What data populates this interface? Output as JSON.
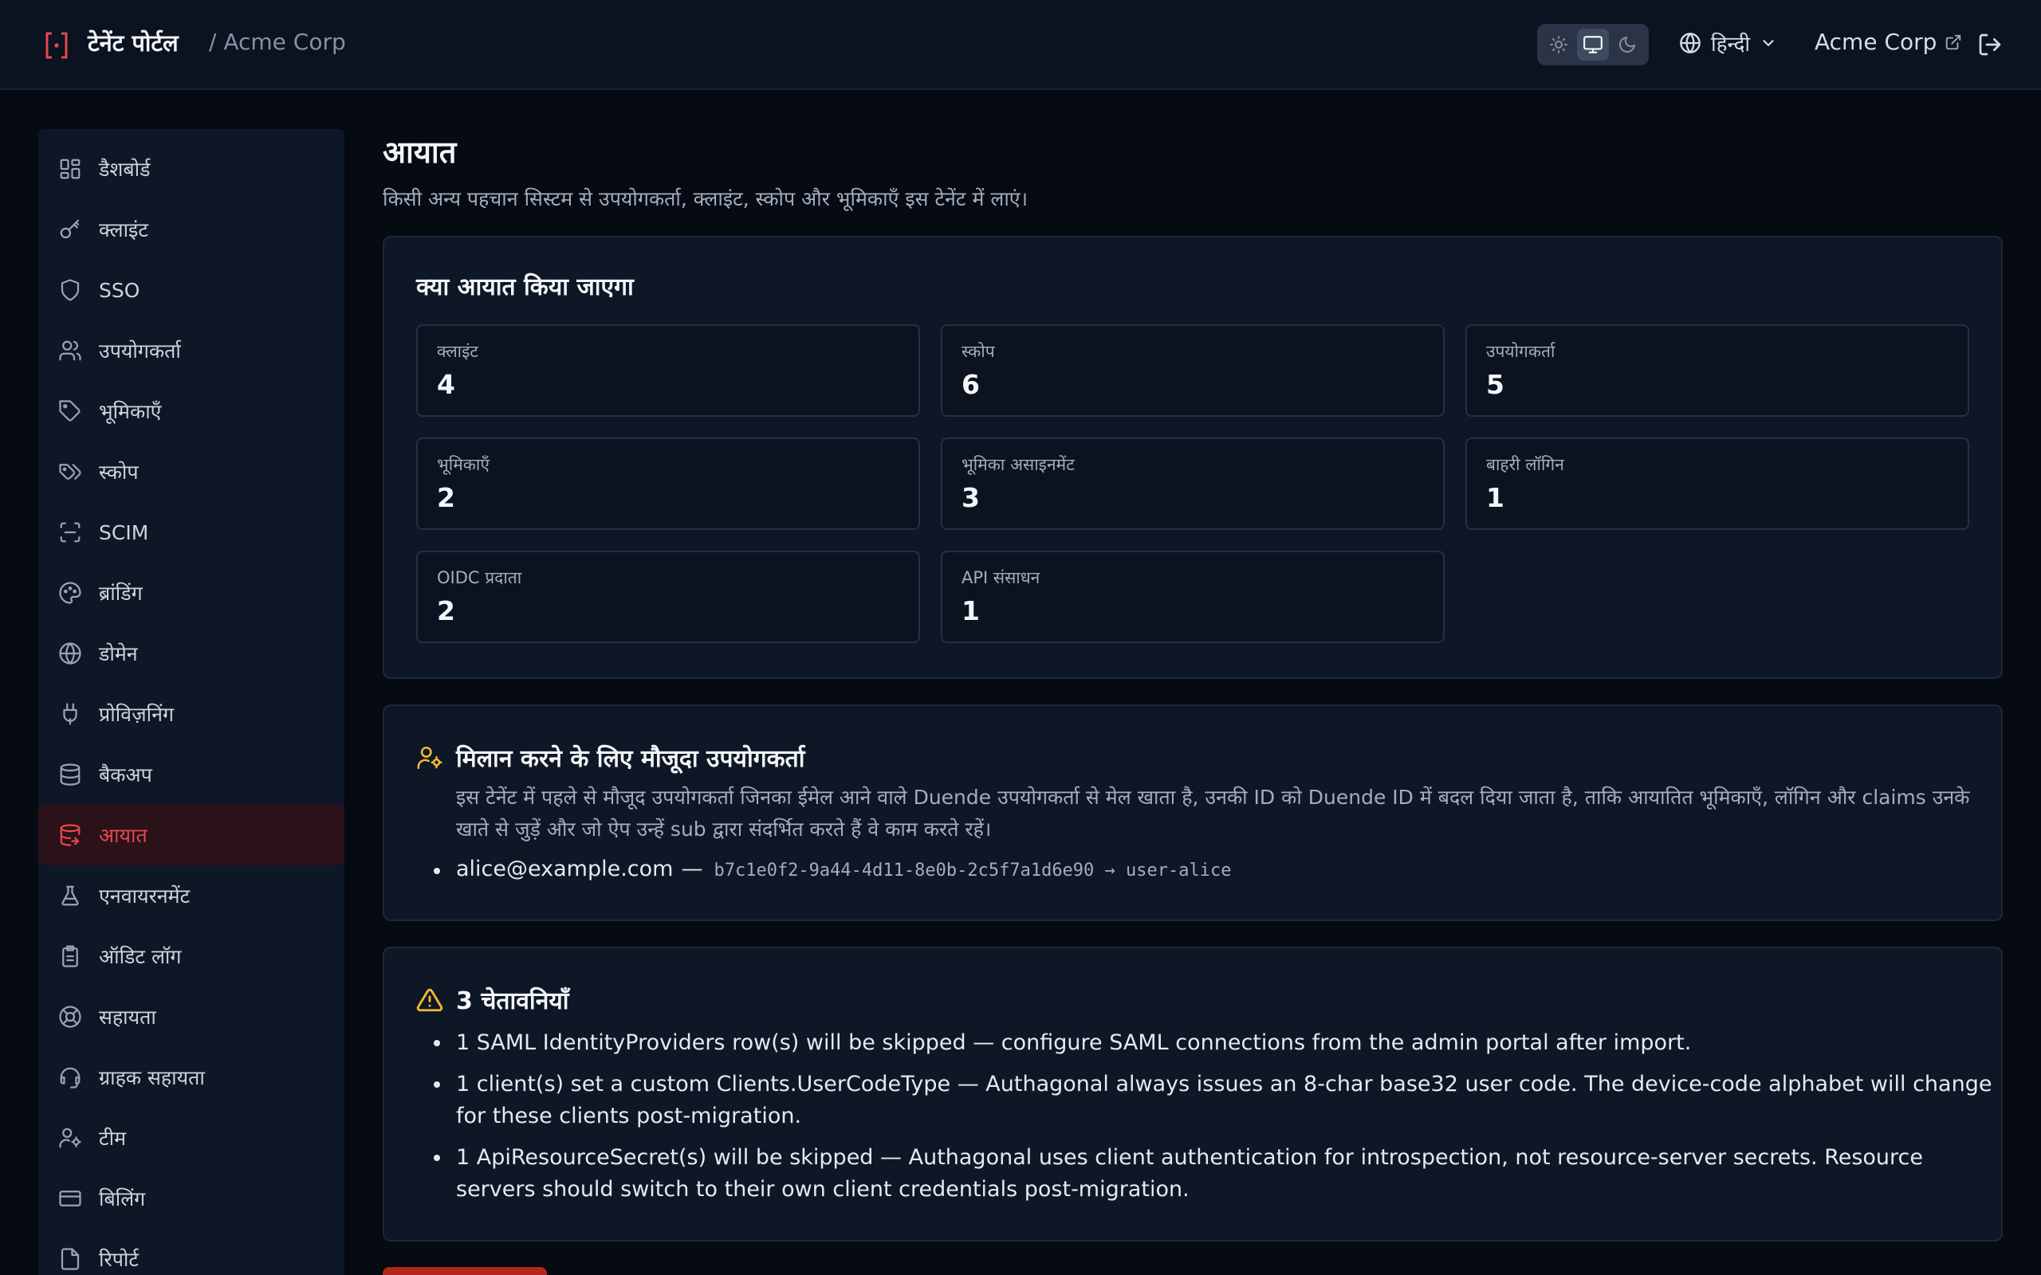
{
  "header": {
    "app_title": "टेनेंट पोर्टल",
    "tenant_crumb": "/ Acme Corp",
    "language": "हिन्दी",
    "org_link": "Acme Corp",
    "theme_options": [
      "sun-icon",
      "monitor-icon",
      "moon-icon"
    ],
    "theme_selected": "monitor-icon"
  },
  "sidebar": {
    "items": [
      {
        "label": "डैशबोर्ड",
        "icon": "dashboard-icon"
      },
      {
        "label": "क्लाइंट",
        "icon": "key-icon"
      },
      {
        "label": "SSO",
        "icon": "shield-icon"
      },
      {
        "label": "उपयोगकर्ता",
        "icon": "users-icon"
      },
      {
        "label": "भूमिकाएँ",
        "icon": "tag-icon"
      },
      {
        "label": "स्कोप",
        "icon": "tags-icon"
      },
      {
        "label": "SCIM",
        "icon": "scan-icon"
      },
      {
        "label": "ब्रांडिंग",
        "icon": "palette-icon"
      },
      {
        "label": "डोमेन",
        "icon": "globe-icon"
      },
      {
        "label": "प्रोविज़निंग",
        "icon": "plug-icon"
      },
      {
        "label": "बैकअप",
        "icon": "database-icon"
      },
      {
        "label": "आयात",
        "icon": "database-import-icon",
        "active": true
      },
      {
        "label": "एनवायरनमेंट",
        "icon": "flask-icon"
      },
      {
        "label": "ऑडिट लॉग",
        "icon": "clipboard-icon"
      },
      {
        "label": "सहायता",
        "icon": "lifebuoy-icon"
      },
      {
        "label": "ग्राहक सहायता",
        "icon": "headset-icon"
      },
      {
        "label": "टीम",
        "icon": "user-cog-icon"
      },
      {
        "label": "बिलिंग",
        "icon": "credit-card-icon"
      },
      {
        "label": "रिपोर्ट",
        "icon": "file-icon"
      }
    ]
  },
  "main": {
    "title": "आयात",
    "subtitle": "किसी अन्य पहचान सिस्टम से उपयोगकर्ता, क्लाइंट, स्कोप और भूमिकाएँ इस टेनेंट में लाएं।",
    "what": {
      "heading": "क्या आयात किया जाएगा",
      "stats": [
        {
          "label": "क्लाइंट",
          "value": "4"
        },
        {
          "label": "स्कोप",
          "value": "6"
        },
        {
          "label": "उपयोगकर्ता",
          "value": "5"
        },
        {
          "label": "भूमिकाएँ",
          "value": "2"
        },
        {
          "label": "भूमिका असाइनमेंट",
          "value": "3"
        },
        {
          "label": "बाहरी लॉगिन",
          "value": "1"
        },
        {
          "label": "OIDC प्रदाता",
          "value": "2"
        },
        {
          "label": "API संसाधन",
          "value": "1"
        }
      ]
    },
    "match": {
      "heading": "मिलान करने के लिए मौजूदा उपयोगकर्ता",
      "description": "इस टेनेंट में पहले से मौजूद उपयोगकर्ता जिनका ईमेल आने वाले Duende उपयोगकर्ता से मेल खाता है, उनकी ID को Duende ID में बदल दिया जाता है, ताकि आयातित भूमिकाएँ, लॉगिन और claims उनके खाते से जुड़ें और जो ऐप उन्हें sub द्वारा संदर्भित करते हैं वे काम करते रहें।",
      "email": "alice@example.com",
      "separator": "—",
      "mapping": "b7c1e0f2-9a44-4d11-8e0b-2c5f7a1d6e90 → user-alice"
    },
    "warnings": {
      "heading": "3 चेतावनियाँ",
      "items": [
        "1 SAML IdentityProviders row(s) will be skipped — configure SAML connections from the admin portal after import.",
        "1 client(s) set a custom Clients.UserCodeType — Authagonal always issues an 8-char base32 user code. The device-code alphabet will change for these clients post-migration.",
        "1 ApiResourceSecret(s) will be skipped — Authagonal uses client authentication for introspection, not resource-server secrets. Resource servers should switch to their own client credentials post-migration."
      ]
    }
  },
  "colors": {
    "accent": "#e5484d",
    "warning": "#f5b82e",
    "background": "#050a13",
    "card": "#0e1726",
    "primary_button": "#b3261e"
  }
}
